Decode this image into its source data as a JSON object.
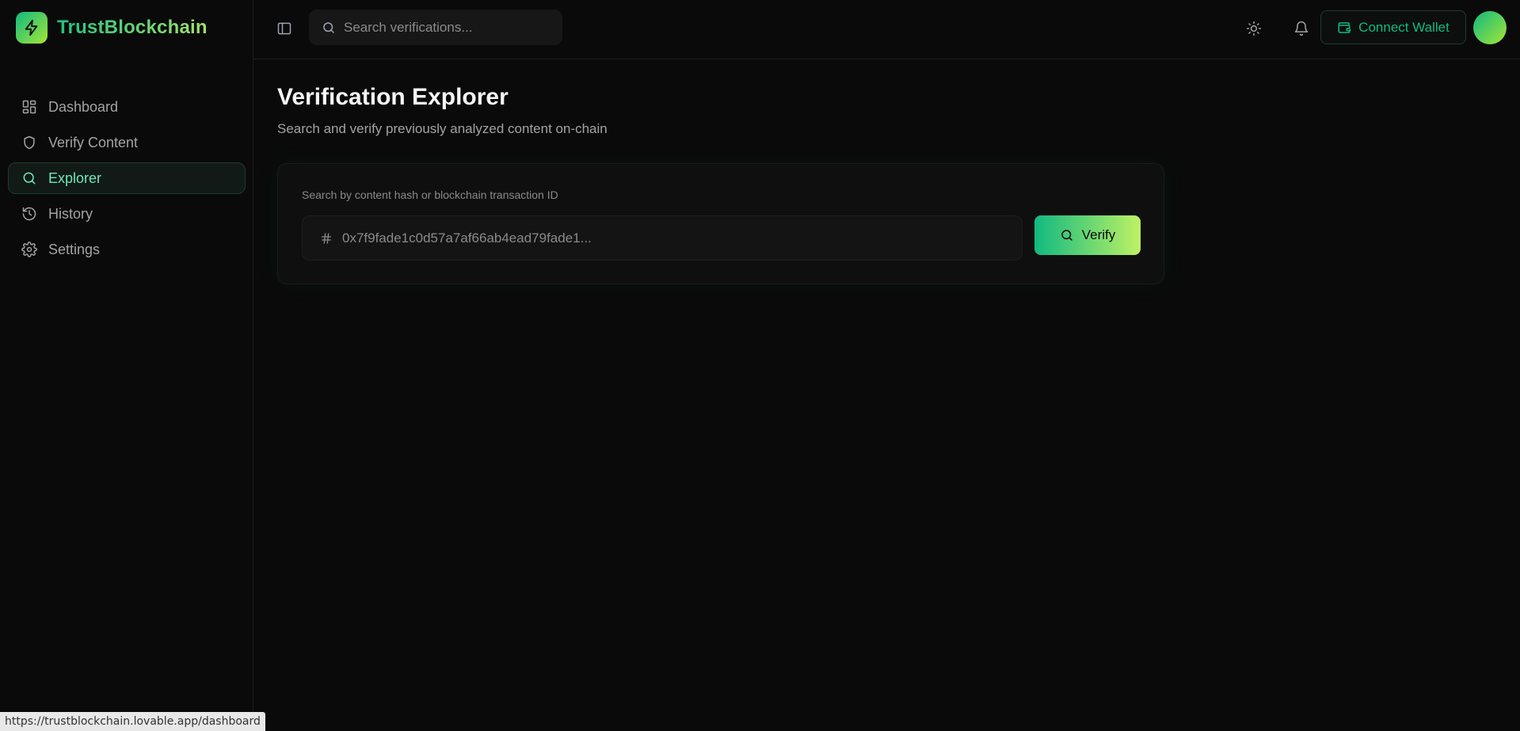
{
  "app": {
    "brand_name": "TrustBlockchain",
    "accent_color": "#10b981",
    "accent_gradient_end": "#a3e635"
  },
  "sidebar": {
    "items": [
      {
        "label": "Dashboard",
        "icon": "dashboard-grid-icon",
        "active": false
      },
      {
        "label": "Verify Content",
        "icon": "shield-icon",
        "active": false
      },
      {
        "label": "Explorer",
        "icon": "search-icon",
        "active": true
      },
      {
        "label": "History",
        "icon": "history-icon",
        "active": false
      },
      {
        "label": "Settings",
        "icon": "gear-icon",
        "active": false
      }
    ]
  },
  "topbar": {
    "search_placeholder": "Search verifications...",
    "connect_wallet_label": "Connect Wallet"
  },
  "main": {
    "title": "Verification Explorer",
    "subtitle": "Search and verify previously analyzed content on-chain",
    "card": {
      "label": "Search by content hash or blockchain transaction ID",
      "input_placeholder": "0x7f9fade1c0d57a7af66ab4ead79fade1...",
      "verify_label": "Verify"
    }
  },
  "status_bar": {
    "url": "https://trustblockchain.lovable.app/dashboard"
  }
}
